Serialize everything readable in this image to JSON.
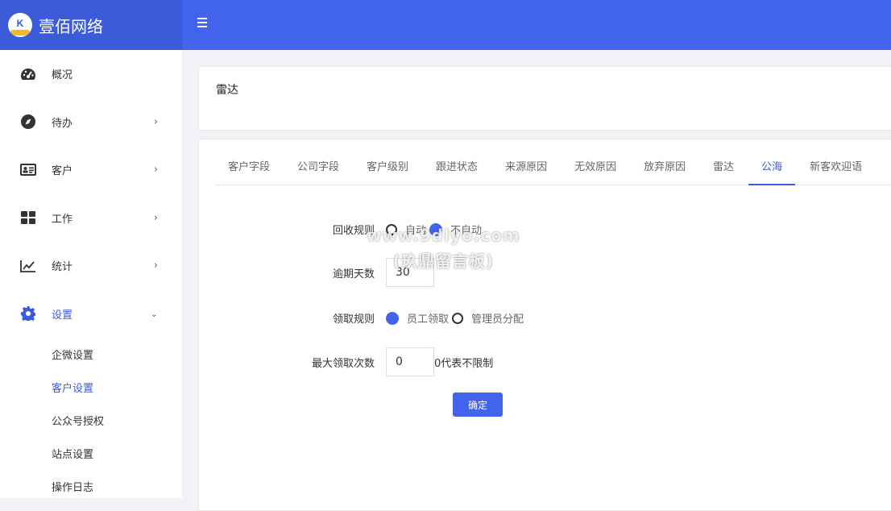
{
  "brand": {
    "name": "壹佰网络",
    "logo_text": "K"
  },
  "sidebar": {
    "items": [
      {
        "label": "概况",
        "icon": "dashboard-icon",
        "has_chevron": false
      },
      {
        "label": "待办",
        "icon": "compass-icon",
        "has_chevron": true
      },
      {
        "label": "客户",
        "icon": "id-card-icon",
        "has_chevron": true
      },
      {
        "label": "工作",
        "icon": "grid-icon",
        "has_chevron": true
      },
      {
        "label": "统计",
        "icon": "line-chart-icon",
        "has_chevron": true
      },
      {
        "label": "设置",
        "icon": "gear-icon",
        "has_chevron": true,
        "expanded": true
      }
    ],
    "sub_items": [
      {
        "label": "企微设置"
      },
      {
        "label": "客户设置",
        "active": true
      },
      {
        "label": "公众号授权"
      },
      {
        "label": "站点设置"
      },
      {
        "label": "操作日志"
      }
    ]
  },
  "header": {
    "menu_icon": "hamburger-icon"
  },
  "page": {
    "title": "雷达"
  },
  "tabs": [
    "客户字段",
    "公司字段",
    "客户级别",
    "跟进状态",
    "来源原因",
    "无效原因",
    "放弃原因",
    "雷达",
    "公海",
    "新客欢迎语"
  ],
  "active_tab": "公海",
  "form": {
    "recycle_rule": {
      "label": "回收规则",
      "options": [
        "自动",
        "不自动"
      ],
      "selected": "不自动"
    },
    "overdue_days": {
      "label": "逾期天数",
      "value": "30"
    },
    "claim_rule": {
      "label": "领取规则",
      "options": [
        "员工领取",
        "管理员分配"
      ],
      "selected": "员工领取"
    },
    "max_claims": {
      "label": "最大领取次数",
      "value": "0",
      "hint": "0代表不限制"
    },
    "submit_label": "确定"
  },
  "watermark": {
    "line1": "www.9dlyo.com",
    "line2": "(玖鼎留言板)"
  },
  "colors": {
    "accent": "#4263eb",
    "brand_bar": "#3b5bdb",
    "background": "#f0f2f5"
  }
}
